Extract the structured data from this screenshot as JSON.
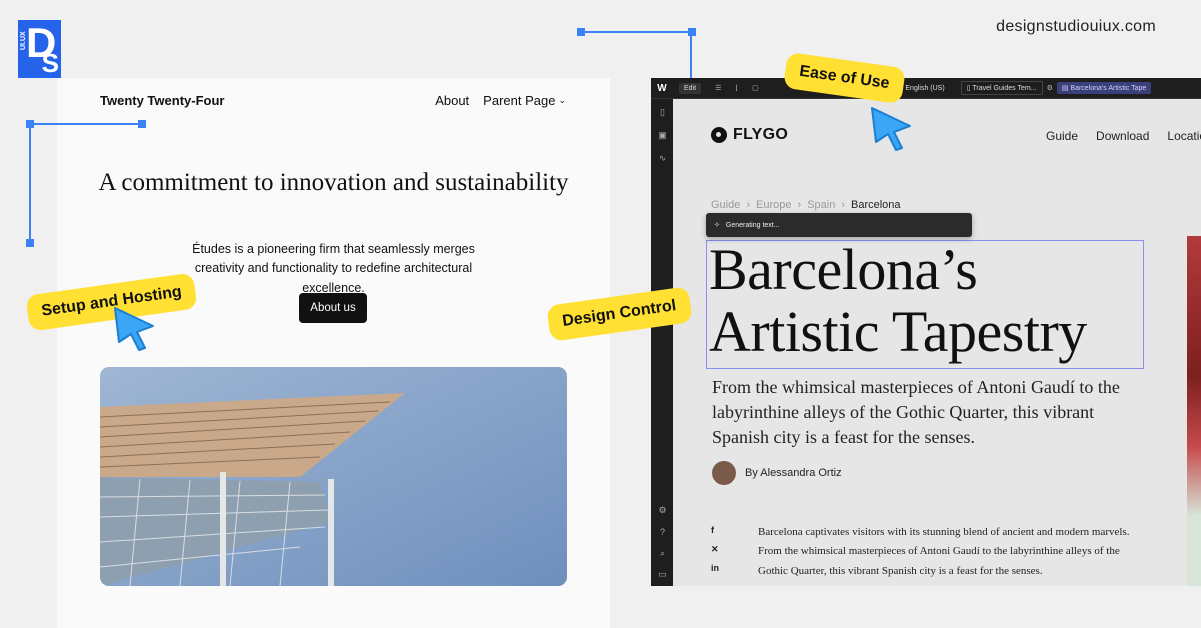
{
  "brand": {
    "logo_small": "UI.UX",
    "logo_big": "D",
    "logo_s": "S",
    "domain": "designstudiouiux.com"
  },
  "wp": {
    "site_title": "Twenty Twenty-Four",
    "nav": [
      "About",
      "Parent Page"
    ],
    "heading": "A commitment to innovation and sustainability",
    "lead": "Études is a pioneering firm that seamlessly merges creativity and functionality to redefine architectural excellence.",
    "button": "About us"
  },
  "callouts": {
    "setup": "Setup and Hosting",
    "design": "Design Control",
    "ease": "Ease of Use"
  },
  "editor": {
    "toolbar": {
      "logo": "W",
      "edit": "Edit",
      "lang": "English (US)",
      "page": "Travel Guides Tem...",
      "selected": "Barcelona's Artistic Tape"
    },
    "site": {
      "name": "FLYGO",
      "nav": [
        "Guide",
        "Download",
        "Location"
      ],
      "crumbs": [
        "Guide",
        "Europe",
        "Spain",
        "Barcelona"
      ],
      "generating": "Generating text...",
      "title": "Barcelona’s Artistic Tapestry",
      "subtitle": "From the whimsical masterpieces of Antoni Gaudí to the labyrinthine alleys of the Gothic Quarter, this vibrant Spanish city is a feast for the senses.",
      "author": "By Alessandra Ortiz",
      "social": [
        "facebook-icon",
        "x-icon",
        "linkedin-icon"
      ],
      "body": "Barcelona captivates visitors with its stunning blend of ancient and modern marvels. From the whimsical masterpieces of Antoni Gaudí to the labyrinthine alleys of the Gothic Quarter, this vibrant Spanish city is a feast for the senses."
    }
  }
}
